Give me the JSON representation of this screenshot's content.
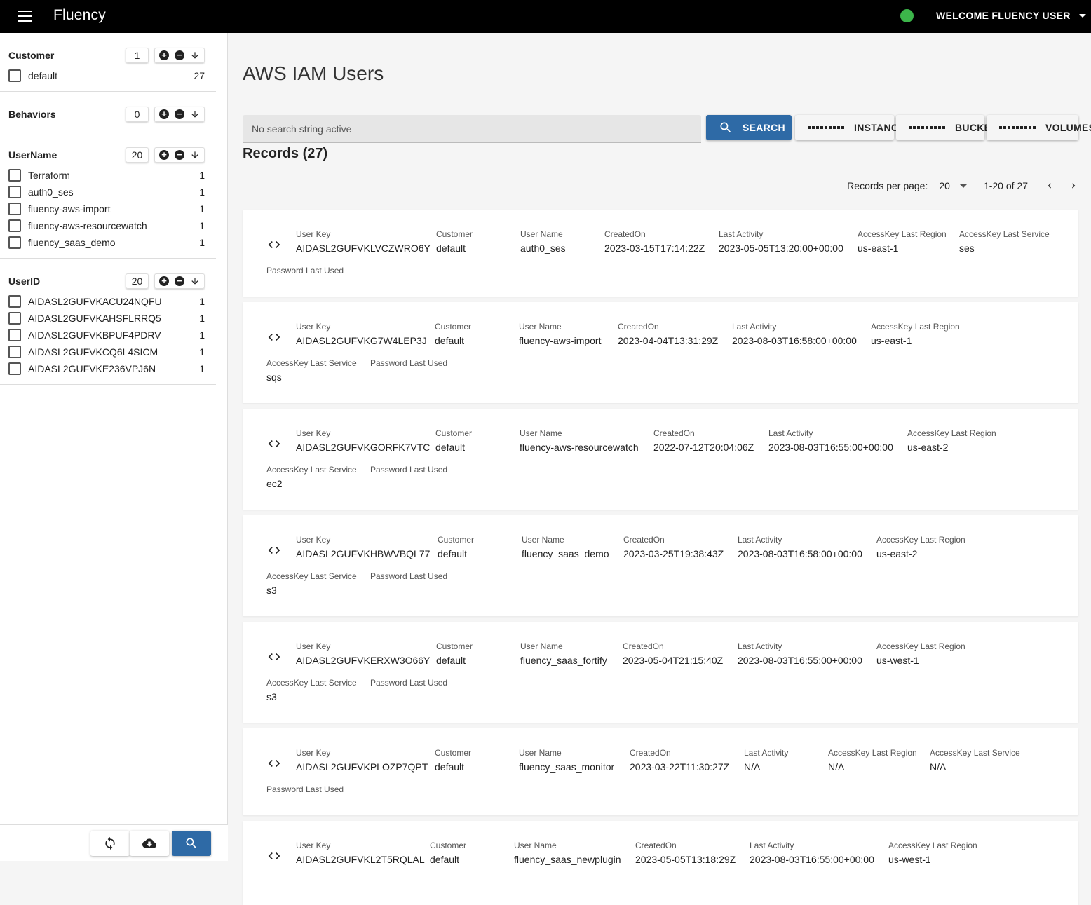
{
  "header": {
    "title": "Fluency",
    "welcome": "WELCOME FLUENCY USER",
    "status_color": "#3cb54a"
  },
  "sidebar": {
    "facets": [
      {
        "title": "Customer",
        "count": "1",
        "items": [
          {
            "label": "default",
            "count": "27"
          }
        ]
      },
      {
        "title": "Behaviors",
        "count": "0",
        "items": []
      },
      {
        "title": "UserName",
        "count": "20",
        "items": [
          {
            "label": "Terraform",
            "count": "1"
          },
          {
            "label": "auth0_ses",
            "count": "1"
          },
          {
            "label": "fluency-aws-import",
            "count": "1"
          },
          {
            "label": "fluency-aws-resourcewatch",
            "count": "1"
          },
          {
            "label": "fluency_saas_demo",
            "count": "1"
          }
        ]
      },
      {
        "title": "UserID",
        "count": "20",
        "items": [
          {
            "label": "AIDASL2GUFVKACU24NQFU",
            "count": "1"
          },
          {
            "label": "AIDASL2GUFVKAHSFLRRQ5",
            "count": "1"
          },
          {
            "label": "AIDASL2GUFVKBPUF4PDRV",
            "count": "1"
          },
          {
            "label": "AIDASL2GUFVKCQ6L4SICM",
            "count": "1"
          },
          {
            "label": "AIDASL2GUFVKE236VPJ6N",
            "count": "1"
          }
        ]
      }
    ]
  },
  "main": {
    "title": "AWS IAM Users",
    "search_text": "No search string active",
    "buttons": {
      "search": "SEARCH",
      "instances": "INSTANCES",
      "buckets": "BUCKETS",
      "volumes": "VOLUMES"
    },
    "records_title": "Records (27)",
    "pager": {
      "label": "Records per page:",
      "per_page": "20",
      "range": "1-20 of 27"
    },
    "labels": {
      "user_key": "User Key",
      "customer": "Customer",
      "user_name": "User Name",
      "created_on": "CreatedOn",
      "last_activity": "Last Activity",
      "region": "AccessKey Last Region",
      "service": "AccessKey Last Service",
      "password": "Password Last Used"
    },
    "records": [
      {
        "user_key": "AIDASL2GUFVKLVCZWRO6Y",
        "customer": "default",
        "user_name": "auth0_ses",
        "created_on": "2023-03-15T17:14:22Z",
        "last_activity": "2023-05-05T13:20:00+00:00",
        "region": "us-east-1",
        "service": "ses",
        "password": ""
      },
      {
        "user_key": "AIDASL2GUFVKG7W4LEP3J",
        "customer": "default",
        "user_name": "fluency-aws-import",
        "created_on": "2023-04-04T13:31:29Z",
        "last_activity": "2023-08-03T16:58:00+00:00",
        "region": "us-east-1",
        "service": "sqs",
        "password": ""
      },
      {
        "user_key": "AIDASL2GUFVKGORFK7VTC",
        "customer": "default",
        "user_name": "fluency-aws-resourcewatch",
        "created_on": "2022-07-12T20:04:06Z",
        "last_activity": "2023-08-03T16:55:00+00:00",
        "region": "us-east-2",
        "service": "ec2",
        "password": ""
      },
      {
        "user_key": "AIDASL2GUFVKHBWVBQL77",
        "customer": "default",
        "user_name": "fluency_saas_demo",
        "created_on": "2023-03-25T19:38:43Z",
        "last_activity": "2023-08-03T16:58:00+00:00",
        "region": "us-east-2",
        "service": "s3",
        "password": ""
      },
      {
        "user_key": "AIDASL2GUFVKERXW3O66Y",
        "customer": "default",
        "user_name": "fluency_saas_fortify",
        "created_on": "2023-05-04T21:15:40Z",
        "last_activity": "2023-08-03T16:55:00+00:00",
        "region": "us-west-1",
        "service": "s3",
        "password": ""
      },
      {
        "user_key": "AIDASL2GUFVKPLOZP7QPT",
        "customer": "default",
        "user_name": "fluency_saas_monitor",
        "created_on": "2023-03-22T11:30:27Z",
        "last_activity": "N/A",
        "region": "N/A",
        "service": "N/A",
        "password": ""
      },
      {
        "user_key": "AIDASL2GUFVKL2T5RQLAL",
        "customer": "default",
        "user_name": "fluency_saas_newplugin",
        "created_on": "2023-05-05T13:18:29Z",
        "last_activity": "2023-08-03T16:55:00+00:00",
        "region": "us-west-1",
        "service": "",
        "password": ""
      }
    ]
  }
}
